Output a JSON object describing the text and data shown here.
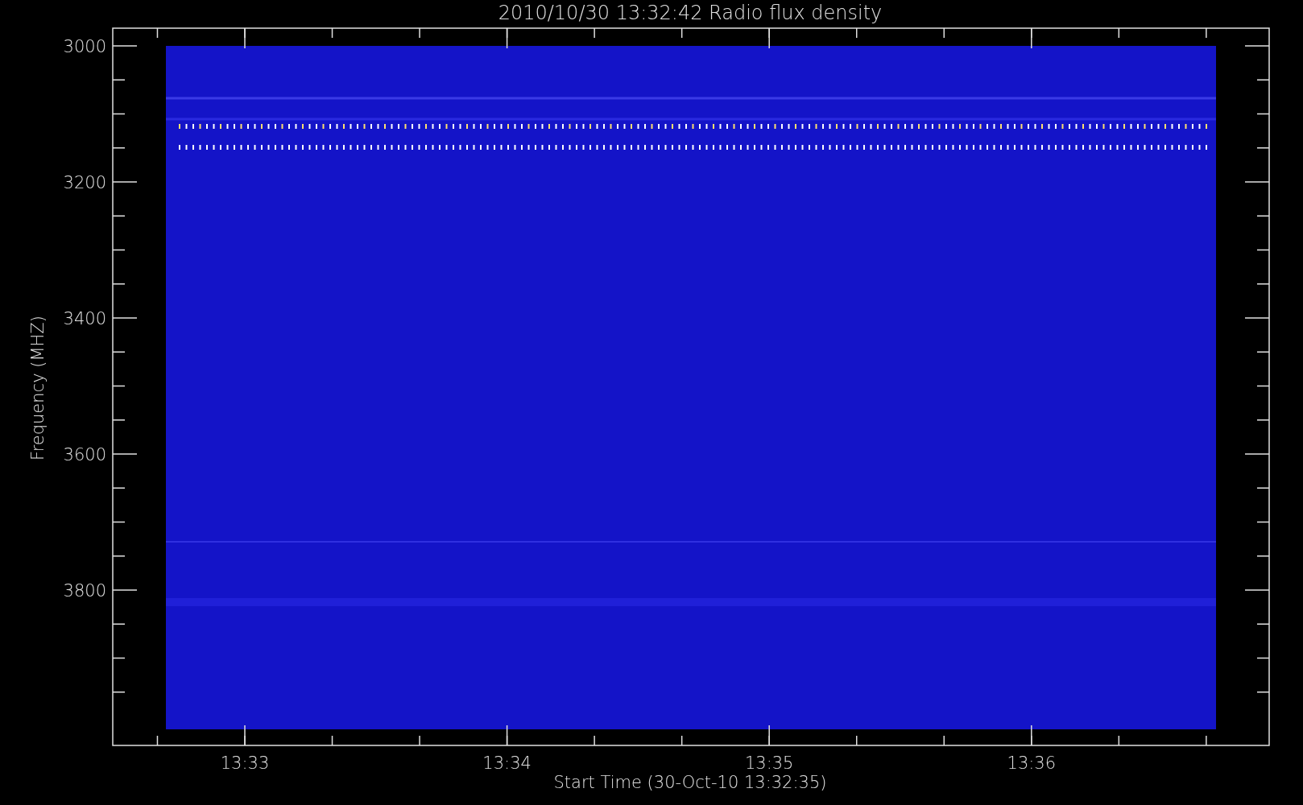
{
  "title": "2010/10/30 13:32:42 Radio flux density",
  "y_axis": {
    "label": "Frequency (MHZ)",
    "ticks": [
      "3000",
      "3200",
      "3400",
      "3600",
      "3800"
    ]
  },
  "x_axis": {
    "label": "Start Time (30-Oct-10 13:32:35)",
    "ticks": [
      "13:33",
      "13:34",
      "13:35",
      "13:36"
    ]
  }
}
